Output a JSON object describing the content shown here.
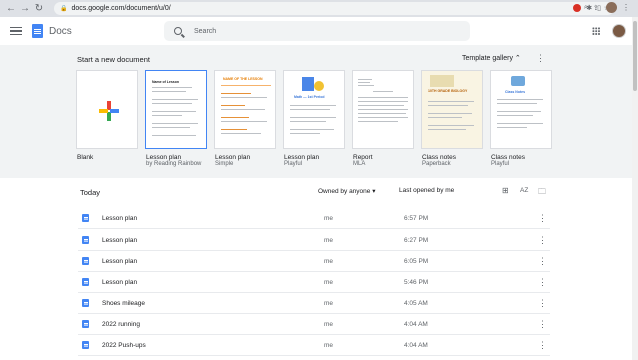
{
  "browser": {
    "url": "docs.google.com/document/u/0/",
    "nav_back": "←",
    "nav_forward": "→",
    "reload": "↻"
  },
  "app": {
    "name": "Docs",
    "search_placeholder": "Search"
  },
  "templates": {
    "header": "Start a new document",
    "gallery_label": "Template gallery ⌃",
    "more": "⋮",
    "items": [
      {
        "title": "Blank",
        "subtitle": ""
      },
      {
        "title": "Lesson plan",
        "subtitle": "by Reading Rainbow"
      },
      {
        "title": "Lesson plan",
        "subtitle": "Simple"
      },
      {
        "title": "Lesson plan",
        "subtitle": "Playful"
      },
      {
        "title": "Report",
        "subtitle": "MLA"
      },
      {
        "title": "Class notes",
        "subtitle": "Paperback"
      },
      {
        "title": "Class notes",
        "subtitle": "Playful"
      }
    ],
    "thumb_texts": {
      "lesson_simple": "NAME OF THE LESSON",
      "lesson_playful": "Math — 1st Period",
      "class_paperback": "10TH GRADE BIOLOGY",
      "class_playful": "Class Notes",
      "reading_title": "Name of Lesson"
    }
  },
  "files": {
    "section": "Today",
    "owner_filter": "Owned by anyone ▾",
    "sort_label": "Last opened by me",
    "view_grid": "⊞",
    "view_sort": "AZ",
    "view_folder": "🗀",
    "rows": [
      {
        "name": "Lesson plan",
        "owner": "me",
        "time": "6:57 PM"
      },
      {
        "name": "Lesson plan",
        "owner": "me",
        "time": "6:27 PM"
      },
      {
        "name": "Lesson plan",
        "owner": "me",
        "time": "6:05 PM"
      },
      {
        "name": "Lesson plan",
        "owner": "me",
        "time": "5:46 PM"
      },
      {
        "name": "Shoes mileage",
        "owner": "me",
        "time": "4:05 AM"
      },
      {
        "name": "2022 running",
        "owner": "me",
        "time": "4:04 AM"
      },
      {
        "name": "2022 Push-ups",
        "owner": "me",
        "time": "4:04 AM"
      }
    ],
    "row_more": "⋮"
  }
}
